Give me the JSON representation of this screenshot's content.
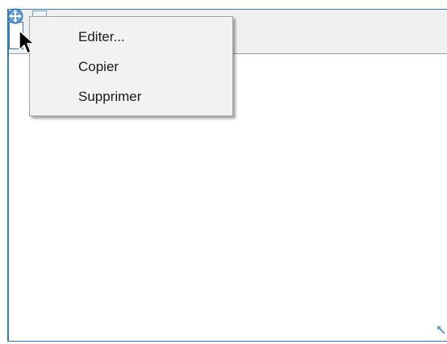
{
  "context_menu": {
    "items": [
      {
        "label": "Editer..."
      },
      {
        "label": "Copier"
      },
      {
        "label": "Supprimer"
      }
    ]
  },
  "icons": {
    "move": "move-handle-icon",
    "cursor": "mouse-pointer-icon",
    "resize": "resize-handle-icon"
  },
  "colors": {
    "frame_border": "#2f7cc4",
    "menu_background": "#f2f2f2",
    "header_background": "#f0f0f0"
  }
}
